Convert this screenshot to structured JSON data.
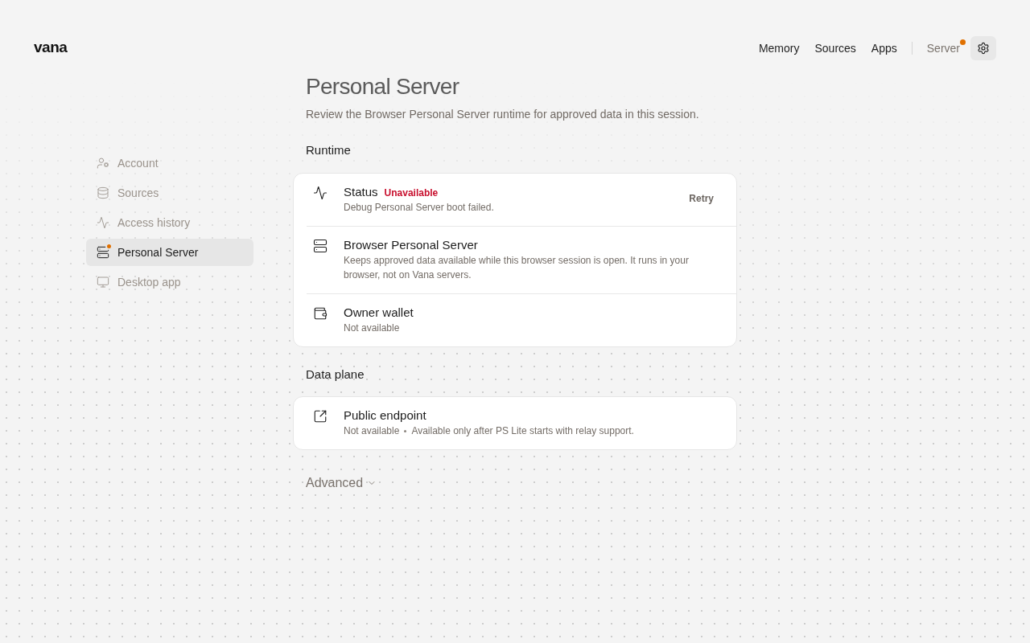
{
  "header": {
    "logo": "vana",
    "nav": [
      {
        "label": "Memory",
        "kind": "link",
        "badge": false
      },
      {
        "label": "Sources",
        "kind": "link",
        "badge": false
      },
      {
        "label": "Apps",
        "kind": "link",
        "badge": false
      },
      {
        "label": "Server",
        "kind": "status",
        "badge": true
      }
    ],
    "settings_button": {
      "selected": true
    }
  },
  "sidebar": {
    "items": [
      {
        "label": "Account",
        "selected": false,
        "badge": false
      },
      {
        "label": "Sources",
        "selected": false,
        "badge": false
      },
      {
        "label": "Access history",
        "selected": false,
        "badge": false
      },
      {
        "label": "Personal Server",
        "selected": true,
        "badge": true
      },
      {
        "label": "Desktop app",
        "selected": false,
        "badge": false
      }
    ]
  },
  "page": {
    "title": "Personal Server",
    "subtitle": "Review the Browser Personal Server runtime for approved data in this session.",
    "sections": [
      {
        "heading": "Runtime",
        "rows": [
          {
            "title": "Status",
            "status": {
              "label": "Unavailable",
              "error": true
            },
            "details": [
              "Debug Personal Server boot failed."
            ],
            "action": "Retry"
          },
          {
            "title": "Browser Personal Server",
            "details": [
              "Keeps approved data available while this browser session is open. It runs in your browser, not on Vana servers."
            ]
          },
          {
            "title": "Owner wallet",
            "details": [
              "Not available"
            ]
          }
        ]
      },
      {
        "heading": "Data plane",
        "rows": [
          {
            "title": "Public endpoint",
            "details": [
              "Not available",
              "Available only after PS Lite starts with relay support."
            ]
          }
        ]
      }
    ],
    "advanced": {
      "label": "Advanced",
      "expanded": false
    }
  }
}
